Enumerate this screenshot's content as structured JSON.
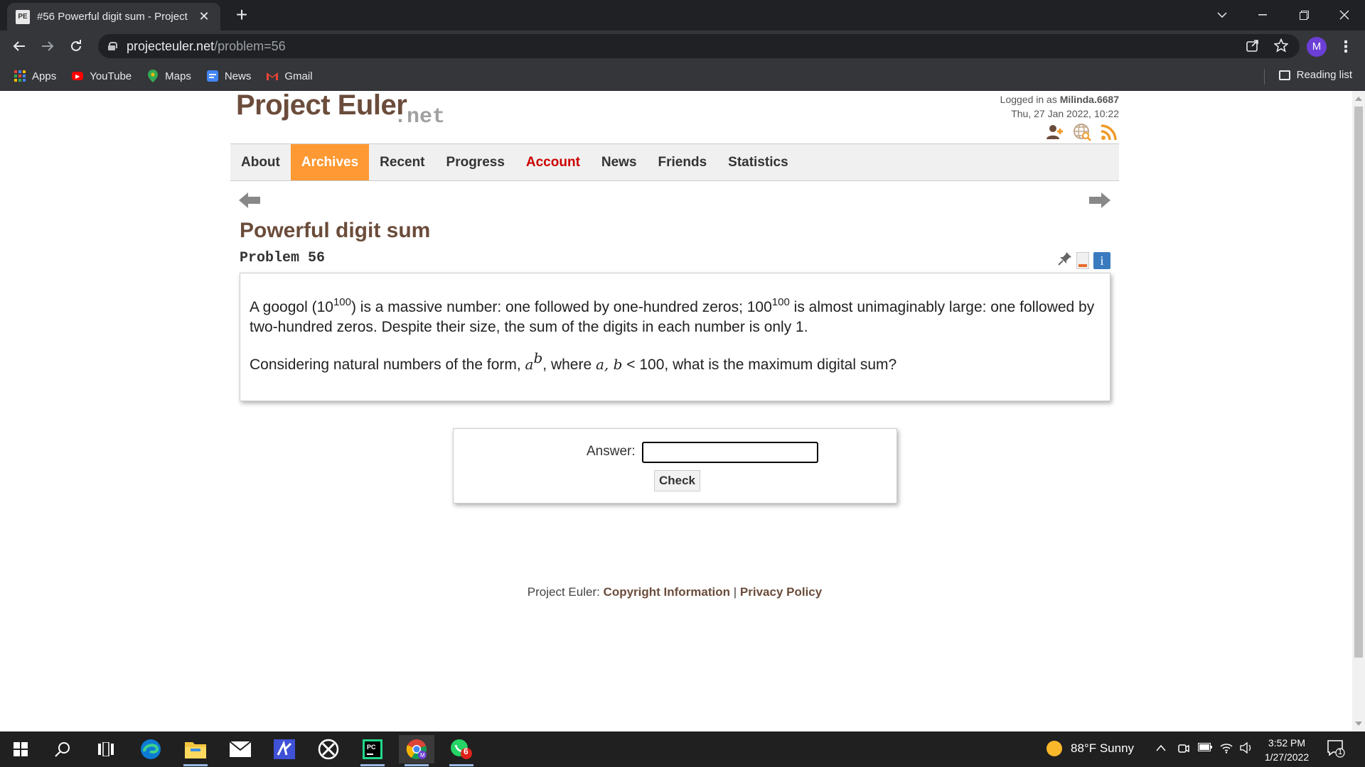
{
  "browser": {
    "tab_title": "#56 Powerful digit sum - Project",
    "tab_favicon": "PE",
    "url_host": "projecteuler.net",
    "url_path": "/problem=56",
    "profile_initial": "M",
    "bookmarks": [
      {
        "label": "Apps",
        "icon": "apps-grid-icon"
      },
      {
        "label": "YouTube",
        "icon": "youtube-icon"
      },
      {
        "label": "Maps",
        "icon": "maps-icon"
      },
      {
        "label": "News",
        "icon": "news-icon"
      },
      {
        "label": "Gmail",
        "icon": "gmail-icon"
      }
    ],
    "reading_list": "Reading list"
  },
  "site": {
    "logo_main": "Project Euler",
    "logo_net": ".net",
    "login_prefix": "Logged in as ",
    "username": "Milinda.6687",
    "datetime": "Thu, 27 Jan 2022, 10:22",
    "nav": [
      {
        "label": "About"
      },
      {
        "label": "Archives"
      },
      {
        "label": "Recent"
      },
      {
        "label": "Progress"
      },
      {
        "label": "Account"
      },
      {
        "label": "News"
      },
      {
        "label": "Friends"
      },
      {
        "label": "Statistics"
      }
    ],
    "active_nav": "Archives"
  },
  "problem": {
    "title": "Powerful digit sum",
    "number": "Problem 56",
    "info_icon": "i",
    "p1_a": "A googol (10",
    "p1_sup1": "100",
    "p1_b": ") is a massive number: one followed by one-hundred zeros; 100",
    "p1_sup2": "100",
    "p1_c": " is almost unimaginably large: one followed by two-hundred zeros. Despite their size, the sum of the digits in each number is only 1.",
    "p2_a": "Considering natural numbers of the form, ",
    "p2_base": "a",
    "p2_exp": "b",
    "p2_b": ", where ",
    "p2_vars": "a, b",
    "p2_c": " < 100, what is the maximum digital sum?"
  },
  "answer": {
    "label": "Answer:",
    "value": "",
    "check_label": "Check"
  },
  "footer": {
    "prefix": "Project Euler: ",
    "copyright": "Copyright Information",
    "sep": " | ",
    "privacy": "Privacy Policy"
  },
  "taskbar": {
    "weather": "88°F  Sunny",
    "time": "3:52 PM",
    "date": "1/27/2022",
    "whatsapp_badge": "6",
    "notif_count": "1"
  },
  "colors": {
    "accent_orange": "#ff9933",
    "brand_brown": "#6b4c3b",
    "account_red": "#cc0000"
  }
}
